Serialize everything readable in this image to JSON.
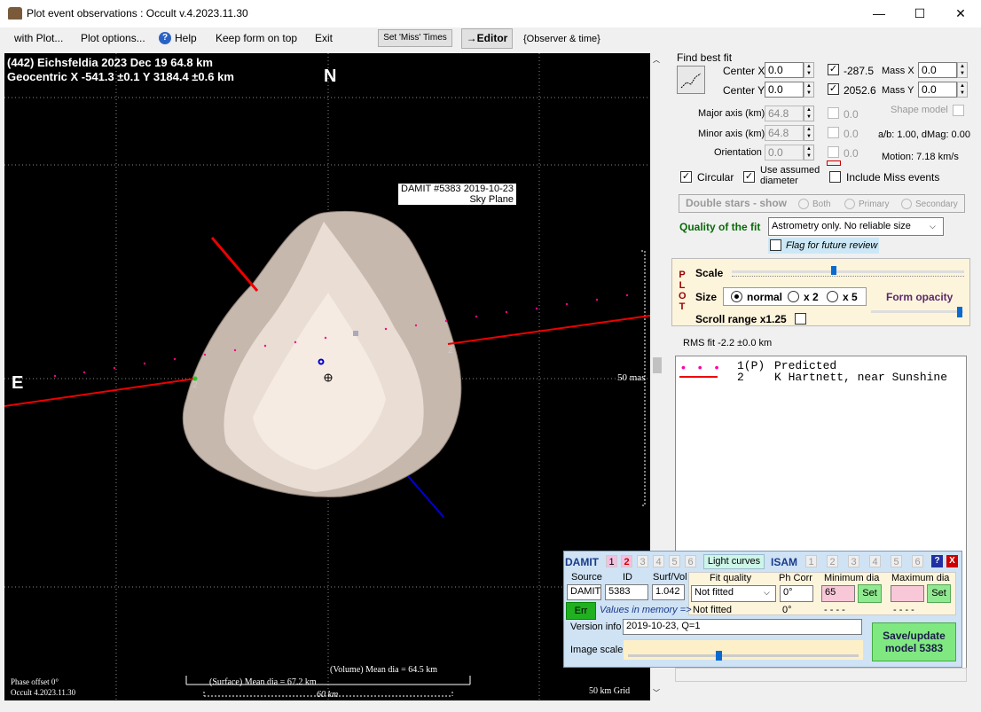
{
  "window": {
    "title": "Plot event observations : Occult v.4.2023.11.30",
    "min": "—",
    "max": "☐",
    "close": "✕"
  },
  "menu": {
    "with_plot": "with Plot...",
    "plot_options": "Plot options...",
    "help": "Help",
    "keep_on_top": "Keep form on top",
    "exit": "Exit",
    "set_miss": "Set 'Miss' Times",
    "editor": "→Editor",
    "observer_time": "{Observer & time}"
  },
  "plot": {
    "line1": "(442) Eichsfeldia  2023 Dec 19  64.8 km",
    "line2": "Geocentric  X  -541.3 ±0.1  Y 3184.4 ±0.6 km",
    "north": "N",
    "east": "E",
    "damit_label": "DAMIT #5383 2019-10-23",
    "sky_plane": "Sky Plane",
    "scale_mas": "50 mas",
    "chord_label": "2",
    "chord_label2": "2",
    "volume_dia": "(Volume) Mean dia = 64.5 km",
    "surface_dia": "(Surface) Mean dia = 67.2 km",
    "km60": "60 km",
    "phase": "Phase offset 0°",
    "version": "Occult 4.2023.11.30",
    "grid": "50 km Grid"
  },
  "fit": {
    "find_best_fit": "Find best fit",
    "center_x": "Center X",
    "center_x_val": "0.0",
    "center_y": "Center Y",
    "center_y_val": "0.0",
    "val_a": "-287.5",
    "val_b": "2052.6",
    "mass_x": "Mass X",
    "mass_x_val": "0.0",
    "mass_y": "Mass Y",
    "mass_y_val": "0.0",
    "major": "Major axis (km)",
    "major_val": "64.8",
    "minor": "Minor axis (km)",
    "minor_val": "64.8",
    "orient": "Orientation",
    "orient_val": "0.0",
    "zero1": "0.0",
    "zero2": "0.0",
    "zero3": "0.0",
    "shape_model": "Shape model",
    "ab": "a/b: 1.00, dMag: 0.00",
    "motion": "Motion: 7.18 km/s",
    "circular": "Circular",
    "use_assumed": "Use assumed",
    "diameter": "diameter",
    "include_miss": "Include Miss events",
    "double_stars": "Double stars - show",
    "both": "Both",
    "primary": "Primary",
    "secondary": "Secondary",
    "quality_label": "Quality of the fit",
    "quality_val": "Astrometry only. No reliable size",
    "flag_review": "Flag for future review"
  },
  "plotpanel": {
    "p": "P",
    "l": "L",
    "o": "O",
    "t": "T",
    "scale": "Scale",
    "size": "Size",
    "normal": "normal",
    "x2": "x 2",
    "x5": "x 5",
    "form_opacity": "Form opacity",
    "scroll_range": "Scroll range x1.25"
  },
  "rms": "RMS fit -2.2 ±0.0 km",
  "legend": {
    "row1": "1(P) Predicted",
    "row1_num": "1(P)",
    "row1_txt": "Predicted",
    "row2_num": "2",
    "row2_txt": "K Hartnett, near Sunshine"
  },
  "damit": {
    "title": "DAMIT",
    "n1": "1",
    "n2": "2",
    "n3": "3",
    "n4": "4",
    "n5": "5",
    "n6": "6",
    "light_curves": "Light curves",
    "isam": "ISAM",
    "i1": "1",
    "i2": "2",
    "i3": "3",
    "i4": "4",
    "i5": "5",
    "i6": "6",
    "help": "?",
    "close": "X",
    "source": "Source",
    "id": "ID",
    "surfvol": "Surf/Vol",
    "fit_quality": "Fit quality",
    "ph_corr": "Ph Corr",
    "min_dia": "Minimum dia",
    "max_dia": "Maximum dia",
    "source_val": "DAMIT",
    "id_val": "5383",
    "surfvol_val": "1.042",
    "fit_val": "Not fitted",
    "ph_val": "0°",
    "min_val": "65",
    "set": "Set",
    "set2": "Set",
    "err": "Err",
    "values_mem": "Values in memory =>",
    "not_fitted": "Not fitted",
    "ph_mem": "0°",
    "dash1": "- - - -",
    "dash2": "- - - -",
    "version_info": "Version info",
    "version_val": "2019-10-23, Q=1",
    "image_scale": "Image scale",
    "save": "Save/update",
    "model": "model 5383"
  }
}
